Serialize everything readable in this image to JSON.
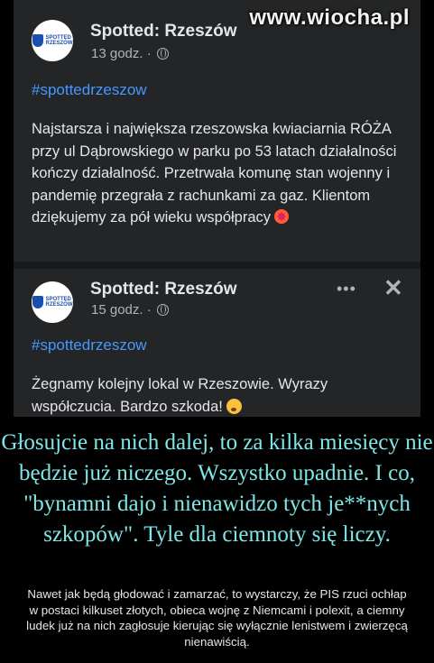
{
  "watermark": "www.wiocha.pl",
  "posts": [
    {
      "author": "Spotted: Rzeszów",
      "time": "13 godz. ·",
      "hashtag": "#spottedrzeszow",
      "text": "Najstarsza i największa rzeszowska kwiaciarnia RÓŻA przy ul Dąbrowskiego w parku po 53 latach działalności kończy działalność. Przetrwała komunę stan wojenny i pandemię przegrała z rachunkami za gaz. Klientom dziękujemy za pół wieku współpracy",
      "emoji": "hibiscus-emoji"
    },
    {
      "author": "Spotted: Rzeszów",
      "time": "15 godz. ·",
      "hashtag": "#spottedrzeszow",
      "text": "Żegnamy kolejny lokal w Rzeszowie. Wyrazy współczucia. Bardzo szkoda!",
      "emoji": "sad-face-emoji",
      "more": "•••",
      "close": "✕"
    }
  ],
  "avatar_text": "SPOTTED RZESZÓW",
  "caption": "Głosujcie na nich dalej, to za kilka miesięcy nie będzie już niczego. Wszystko upadnie. I co, \"bynamni dajo i nienawidzo tych je**nych szkopów\". Tyle dla ciemnoty się liczy.",
  "subcaption": "Nawet jak będą głodować i zamarzać, to wystarczy, że PIS rzuci ochłap w postaci kilkuset złotych, obieca wojnę z Niemcami i polexit, a ciemny ludek już na nich zagłosuje kierując się wyłącznie lenistwem i zwierzęcą nienawiścią.",
  "colors": {
    "hashtag": "#4599ff",
    "caption": "#7fe7e7",
    "card": "#242526"
  }
}
